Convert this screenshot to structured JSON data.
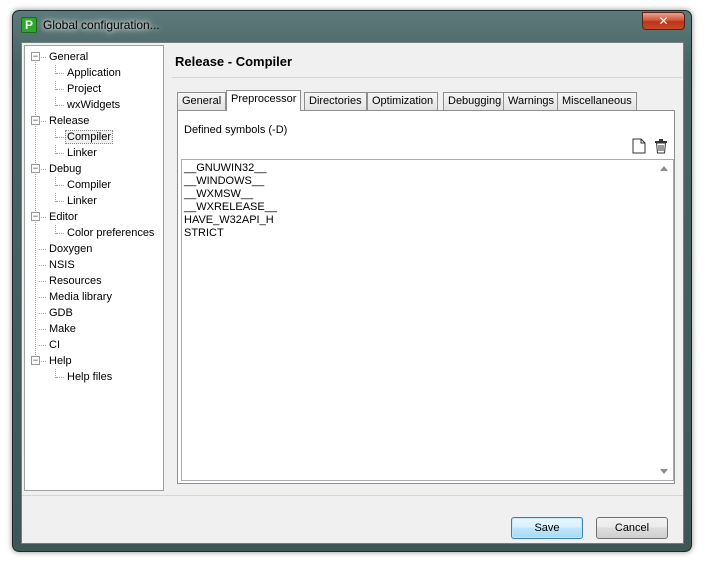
{
  "window": {
    "title": "Global configuration...",
    "close_glyph": "✕",
    "app_icon_letter": "P"
  },
  "tree": [
    {
      "label": "General",
      "level": 0,
      "expanded": true
    },
    {
      "label": "Application",
      "level": 1
    },
    {
      "label": "Project",
      "level": 1
    },
    {
      "label": "wxWidgets",
      "level": 1
    },
    {
      "label": "Release",
      "level": 0,
      "expanded": true
    },
    {
      "label": "Compiler",
      "level": 1,
      "selected": true
    },
    {
      "label": "Linker",
      "level": 1
    },
    {
      "label": "Debug",
      "level": 0,
      "expanded": true
    },
    {
      "label": "Compiler",
      "level": 1
    },
    {
      "label": "Linker",
      "level": 1
    },
    {
      "label": "Editor",
      "level": 0,
      "expanded": true
    },
    {
      "label": "Color preferences",
      "level": 1
    },
    {
      "label": "Doxygen",
      "level": 0
    },
    {
      "label": "NSIS",
      "level": 0
    },
    {
      "label": "Resources",
      "level": 0
    },
    {
      "label": "Media library",
      "level": 0
    },
    {
      "label": "GDB",
      "level": 0
    },
    {
      "label": "Make",
      "level": 0
    },
    {
      "label": "CI",
      "level": 0
    },
    {
      "label": "Help",
      "level": 0,
      "expanded": true
    },
    {
      "label": "Help files",
      "level": 1
    }
  ],
  "panel": {
    "title": "Release - Compiler"
  },
  "tabs": [
    {
      "label": "General"
    },
    {
      "label": "Preprocessor",
      "active": true
    },
    {
      "label": "Directories"
    },
    {
      "label": "Optimization"
    },
    {
      "label": "Debugging"
    },
    {
      "label": "Warnings"
    },
    {
      "label": "Miscellaneous"
    }
  ],
  "preprocessor": {
    "defined_label": "Defined symbols (-D)",
    "new_icon": "new-document-icon",
    "delete_icon": "trash-icon",
    "symbols": [
      "__GNUWIN32__",
      "__WINDOWS__",
      "__WXMSW__",
      "__WXRELEASE__",
      "HAVE_W32API_H",
      "STRICT"
    ]
  },
  "buttons": {
    "save_label": "Save",
    "cancel_label": "Cancel"
  }
}
